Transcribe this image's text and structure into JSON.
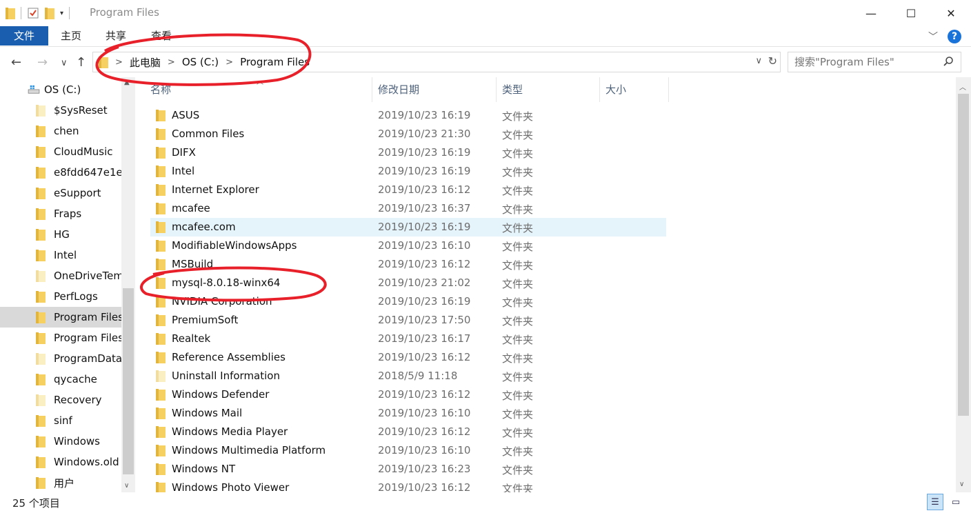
{
  "window": {
    "title": "Program Files",
    "minimize": "—",
    "maximize": "☐",
    "close": "✕"
  },
  "ribbon": {
    "tabs": [
      "文件",
      "主页",
      "共享",
      "查看"
    ]
  },
  "nav": {
    "back": "←",
    "forward": "→",
    "recent": "∨",
    "up": "↑",
    "breadcrumb": [
      "此电脑",
      "OS (C:)",
      "Program Files"
    ],
    "search_placeholder": "搜索\"Program Files\""
  },
  "sidebar": {
    "drive": "OS (C:)",
    "items": [
      {
        "label": "$SysReset",
        "pale": true
      },
      {
        "label": "chen",
        "pale": false
      },
      {
        "label": "CloudMusic",
        "pale": false
      },
      {
        "label": "e8fdd647e1e",
        "pale": false
      },
      {
        "label": "eSupport",
        "pale": false
      },
      {
        "label": "Fraps",
        "pale": false
      },
      {
        "label": "HG",
        "pale": false
      },
      {
        "label": "Intel",
        "pale": false
      },
      {
        "label": "OneDriveTem",
        "pale": true
      },
      {
        "label": "PerfLogs",
        "pale": false
      },
      {
        "label": "Program Files",
        "pale": false
      },
      {
        "label": "Program Files",
        "pale": false
      },
      {
        "label": "ProgramData",
        "pale": true
      },
      {
        "label": "qycache",
        "pale": false
      },
      {
        "label": "Recovery",
        "pale": true
      },
      {
        "label": "sinf",
        "pale": false
      },
      {
        "label": "Windows",
        "pale": false
      },
      {
        "label": "Windows.old",
        "pale": false
      },
      {
        "label": "用户",
        "pale": false
      }
    ],
    "selected_index": 10
  },
  "columns": [
    "名称",
    "修改日期",
    "类型",
    "大小"
  ],
  "files": [
    {
      "name": "ASUS",
      "date": "2019/10/23 16:19",
      "type": "文件夹",
      "pale": false
    },
    {
      "name": "Common Files",
      "date": "2019/10/23 21:30",
      "type": "文件夹",
      "pale": false
    },
    {
      "name": "DIFX",
      "date": "2019/10/23 16:19",
      "type": "文件夹",
      "pale": false
    },
    {
      "name": "Intel",
      "date": "2019/10/23 16:19",
      "type": "文件夹",
      "pale": false
    },
    {
      "name": "Internet Explorer",
      "date": "2019/10/23 16:12",
      "type": "文件夹",
      "pale": false
    },
    {
      "name": "mcafee",
      "date": "2019/10/23 16:37",
      "type": "文件夹",
      "pale": false
    },
    {
      "name": "mcafee.com",
      "date": "2019/10/23 16:19",
      "type": "文件夹",
      "pale": false
    },
    {
      "name": "ModifiableWindowsApps",
      "date": "2019/10/23 16:10",
      "type": "文件夹",
      "pale": false
    },
    {
      "name": "MSBuild",
      "date": "2019/10/23 16:12",
      "type": "文件夹",
      "pale": false
    },
    {
      "name": "mysql-8.0.18-winx64",
      "date": "2019/10/23 21:02",
      "type": "文件夹",
      "pale": false
    },
    {
      "name": "NVIDIA Corporation",
      "date": "2019/10/23 16:19",
      "type": "文件夹",
      "pale": false
    },
    {
      "name": "PremiumSoft",
      "date": "2019/10/23 17:50",
      "type": "文件夹",
      "pale": false
    },
    {
      "name": "Realtek",
      "date": "2019/10/23 16:17",
      "type": "文件夹",
      "pale": false
    },
    {
      "name": "Reference Assemblies",
      "date": "2019/10/23 16:12",
      "type": "文件夹",
      "pale": false
    },
    {
      "name": "Uninstall Information",
      "date": "2018/5/9 11:18",
      "type": "文件夹",
      "pale": true
    },
    {
      "name": "Windows Defender",
      "date": "2019/10/23 16:12",
      "type": "文件夹",
      "pale": false
    },
    {
      "name": "Windows Mail",
      "date": "2019/10/23 16:10",
      "type": "文件夹",
      "pale": false
    },
    {
      "name": "Windows Media Player",
      "date": "2019/10/23 16:12",
      "type": "文件夹",
      "pale": false
    },
    {
      "name": "Windows Multimedia Platform",
      "date": "2019/10/23 16:10",
      "type": "文件夹",
      "pale": false
    },
    {
      "name": "Windows NT",
      "date": "2019/10/23 16:23",
      "type": "文件夹",
      "pale": false
    },
    {
      "name": "Windows Photo Viewer",
      "date": "2019/10/23 16:12",
      "type": "文件夹",
      "pale": false
    }
  ],
  "hover_index": 6,
  "status": {
    "count": "25 个项目"
  },
  "colors": {
    "file_tab": "#1a5eb0",
    "folder": "#f6d060",
    "hover_row": "#e5f3fb",
    "annotation": "#e8202a"
  }
}
